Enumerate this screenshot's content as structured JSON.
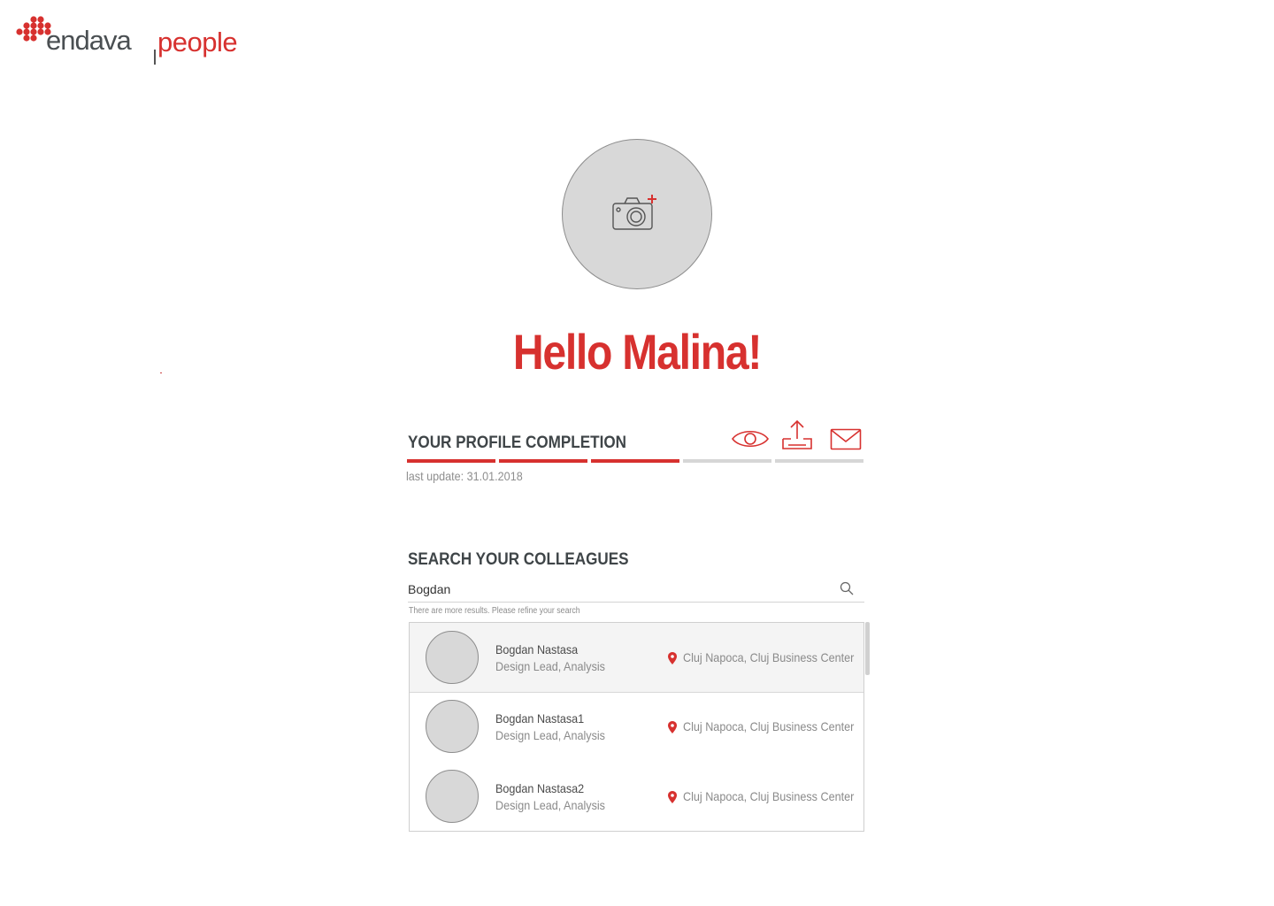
{
  "brand": {
    "logo_text": "endava",
    "product_name": "people",
    "accent_color": "#d7312f",
    "icon": "endava-dots-logo-icon"
  },
  "profile": {
    "avatar_icon": "add-photo-camera-icon",
    "greeting": "Hello Malina!"
  },
  "profile_completion": {
    "title": "YOUR PROFILE COMPLETION",
    "progress_steps_total": 5,
    "progress_steps_completed": 3,
    "last_update": "last update: 31.01.2018",
    "actions": [
      {
        "icon": "eye-icon"
      },
      {
        "icon": "upload-icon"
      },
      {
        "icon": "mail-icon"
      }
    ]
  },
  "search": {
    "title": "SEARCH YOUR COLLEAGUES",
    "query": "Bogdan",
    "icon": "search-icon",
    "hint": "There are more results. Please refine your search",
    "results": [
      {
        "name": "Bogdan Nastasa",
        "role": "Design Lead, Analysis",
        "location": "Cluj Napoca, Cluj Business Center",
        "highlighted": true
      },
      {
        "name": "Bogdan Nastasa1",
        "role": "Design Lead, Analysis",
        "location": "Cluj Napoca, Cluj Business Center",
        "highlighted": false
      },
      {
        "name": "Bogdan Nastasa2",
        "role": "Design Lead, Analysis",
        "location": "Cluj Napoca, Cluj Business Center",
        "highlighted": false
      }
    ]
  }
}
